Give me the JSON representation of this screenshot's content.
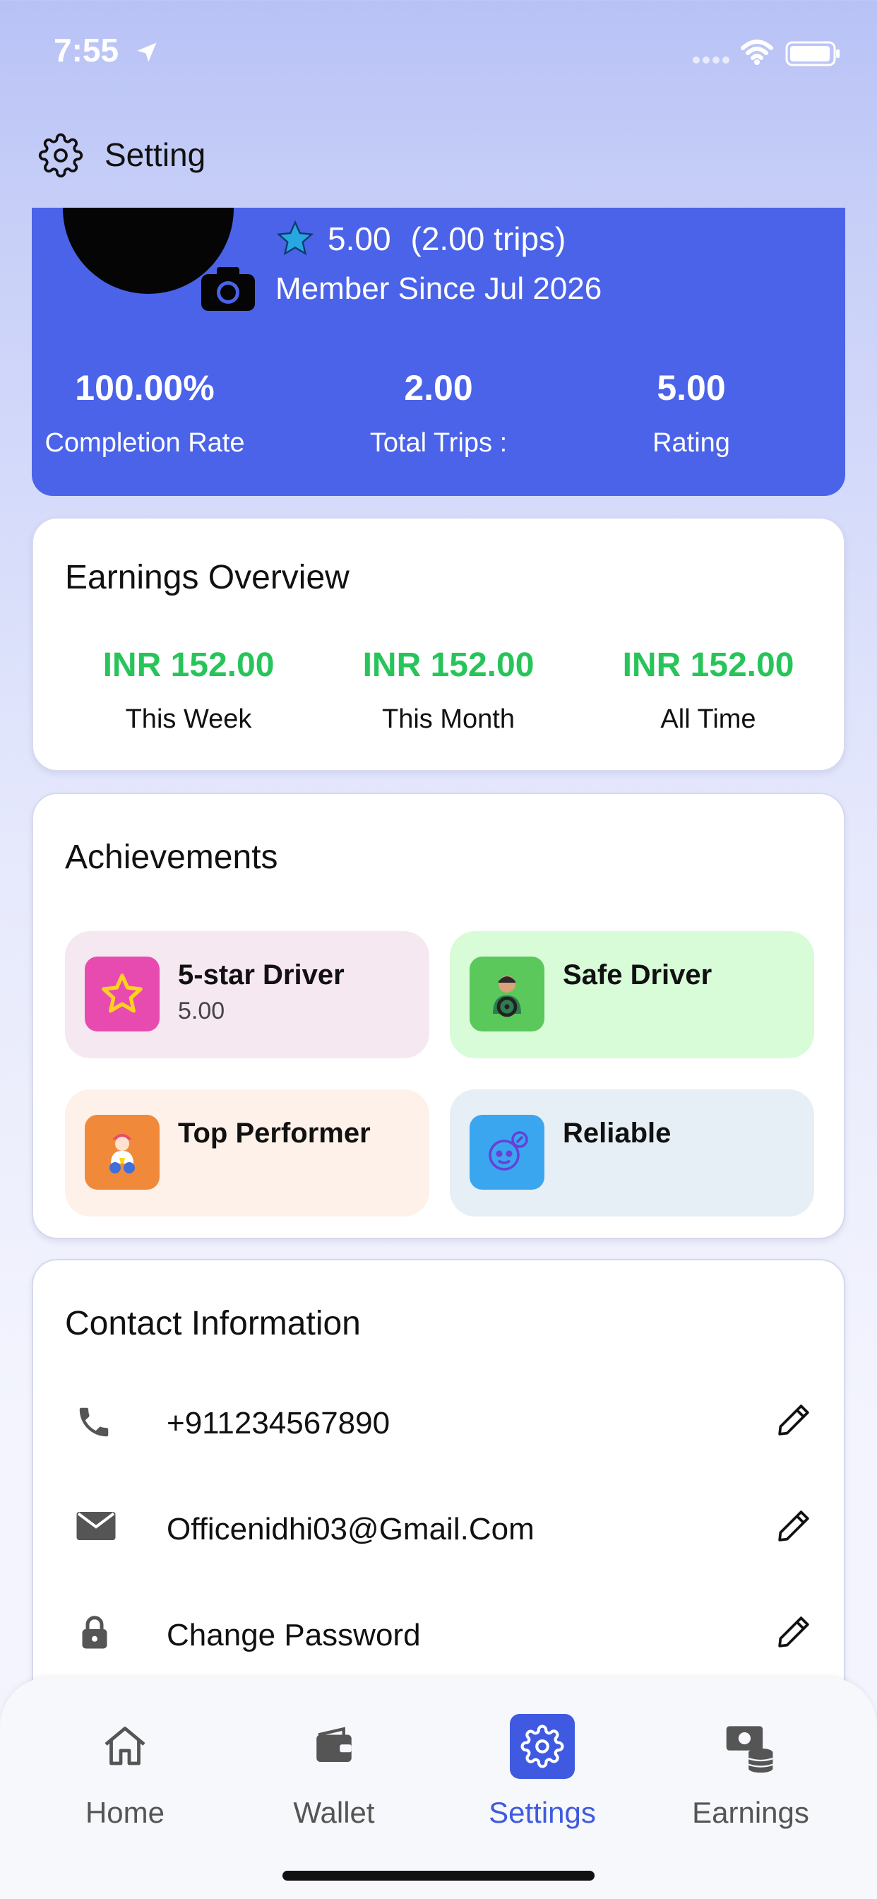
{
  "status_bar": {
    "time": "7:55"
  },
  "header": {
    "title": "Setting"
  },
  "profile": {
    "rating": "5.00",
    "trips": "(2.00 trips)",
    "member_since": "Member Since Jul 2026",
    "stats": [
      {
        "value": "100.00%",
        "label": "Completion Rate"
      },
      {
        "value": "2.00",
        "label": "Total Trips :"
      },
      {
        "value": "5.00",
        "label": "Rating"
      }
    ]
  },
  "earnings": {
    "title": "Earnings Overview",
    "items": [
      {
        "amount": "INR 152.00",
        "label": "This Week"
      },
      {
        "amount": "INR 152.00",
        "label": "This Month"
      },
      {
        "amount": "INR 152.00",
        "label": "All Time"
      }
    ]
  },
  "achievements": {
    "title": "Achievements",
    "items": [
      {
        "name": "5-star Driver",
        "sub": "5.00",
        "icon": "star-badge-icon"
      },
      {
        "name": "Safe Driver",
        "sub": "",
        "icon": "driver-steering-icon"
      },
      {
        "name": "Top Performer",
        "sub": "",
        "icon": "performer-trophy-icon"
      },
      {
        "name": "Reliable",
        "sub": "",
        "icon": "reliable-face-icon"
      }
    ]
  },
  "contact": {
    "title": "Contact Information",
    "rows": [
      {
        "text": "+911234567890",
        "icon": "phone-icon"
      },
      {
        "text": "Officenidhi03@Gmail.Com",
        "icon": "mail-icon"
      },
      {
        "text": "Change Password",
        "icon": "lock-icon"
      }
    ]
  },
  "nav": {
    "items": [
      {
        "label": "Home",
        "icon": "home-icon"
      },
      {
        "label": "Wallet",
        "icon": "wallet-icon"
      },
      {
        "label": "Settings",
        "icon": "gear-icon",
        "active": true
      },
      {
        "label": "Earnings",
        "icon": "earnings-icon"
      }
    ]
  },
  "colors": {
    "primary": "#4a63e8",
    "earnings_green": "#27c45a",
    "active_nav": "#3f5ae0"
  }
}
